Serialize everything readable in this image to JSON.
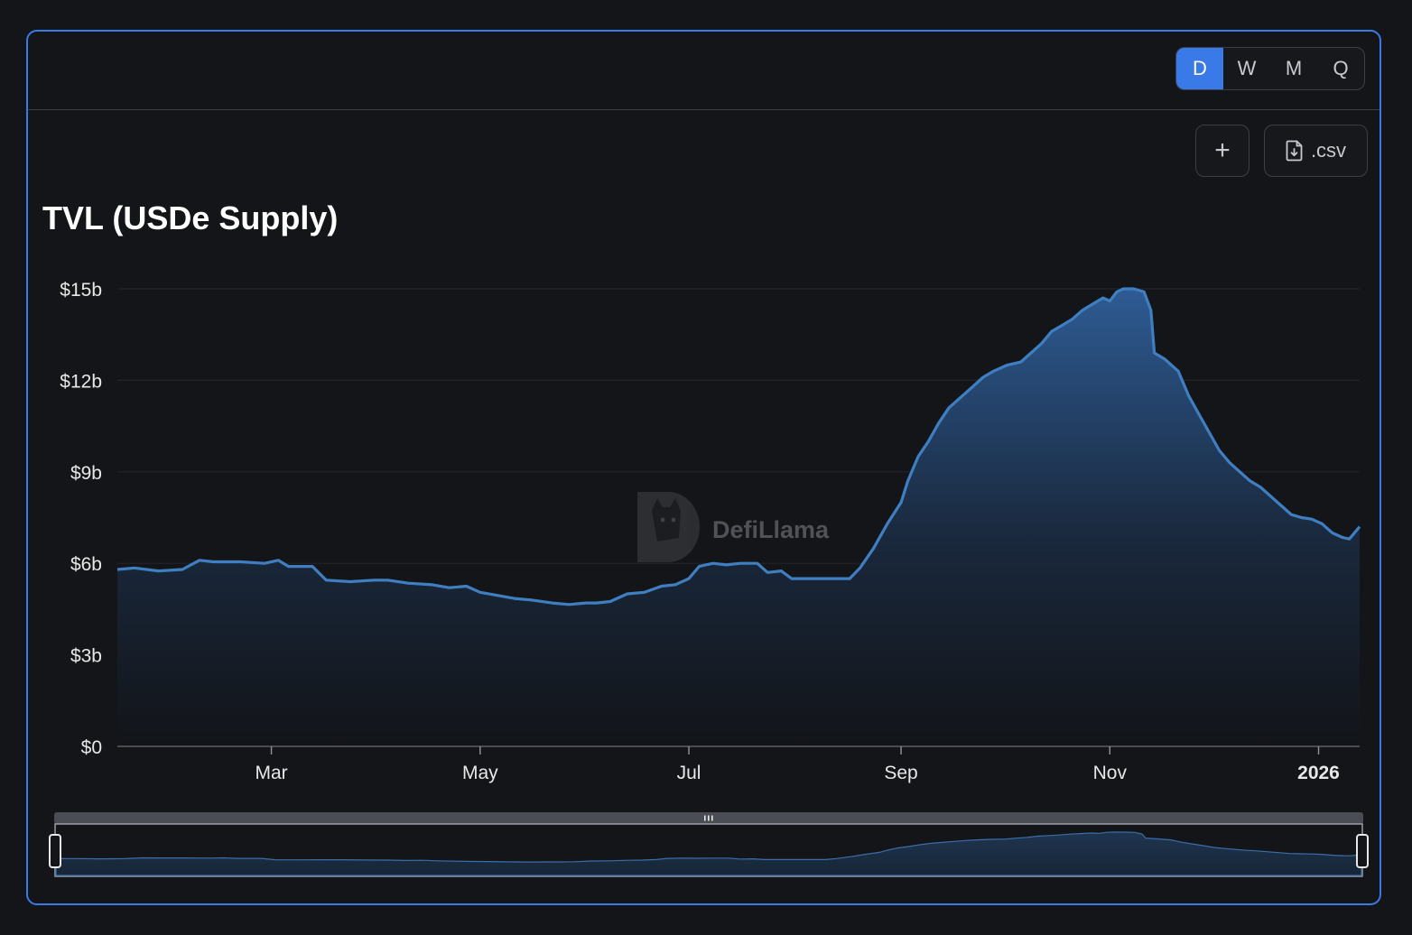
{
  "period_buttons": [
    "D",
    "W",
    "M",
    "Q"
  ],
  "active_period": "D",
  "toolbar": {
    "add_label": "+",
    "csv_label": ".csv"
  },
  "watermark": "DefiLlama",
  "colors": {
    "accent": "#3a7ae8",
    "line": "#3f7fc1",
    "background": "#141518",
    "border": "#3a3f47"
  },
  "chart_data": {
    "type": "area",
    "title": "TVL (USDe Supply)",
    "xlabel": "",
    "ylabel": "",
    "y_unit": "USD billions",
    "ylim": [
      0,
      15
    ],
    "y_ticks": [
      0,
      3,
      6,
      9,
      12,
      15
    ],
    "y_tick_labels": [
      "$0",
      "$3b",
      "$6b",
      "$9b",
      "$12b",
      "$15b"
    ],
    "x_ticks": [
      {
        "date": "2025-03-01",
        "label": "Mar",
        "bold": false
      },
      {
        "date": "2025-05-01",
        "label": "May",
        "bold": false
      },
      {
        "date": "2025-07-01",
        "label": "Jul",
        "bold": false
      },
      {
        "date": "2025-09-01",
        "label": "Sep",
        "bold": false
      },
      {
        "date": "2025-11-01",
        "label": "Nov",
        "bold": false
      },
      {
        "date": "2026-01-01",
        "label": "2026",
        "bold": true
      }
    ],
    "x_range": [
      "2025-01-15",
      "2026-01-13"
    ],
    "grid": true,
    "legend": "none",
    "series": [
      {
        "points": [
          [
            "2025-01-15",
            5.8
          ],
          [
            "2025-01-20",
            5.85
          ],
          [
            "2025-01-27",
            5.75
          ],
          [
            "2025-02-03",
            5.8
          ],
          [
            "2025-02-08",
            6.1
          ],
          [
            "2025-02-12",
            6.05
          ],
          [
            "2025-02-20",
            6.05
          ],
          [
            "2025-02-27",
            6.0
          ],
          [
            "2025-03-03",
            6.1
          ],
          [
            "2025-03-06",
            5.9
          ],
          [
            "2025-03-13",
            5.9
          ],
          [
            "2025-03-17",
            5.45
          ],
          [
            "2025-03-24",
            5.4
          ],
          [
            "2025-03-31",
            5.45
          ],
          [
            "2025-04-04",
            5.45
          ],
          [
            "2025-04-10",
            5.35
          ],
          [
            "2025-04-17",
            5.3
          ],
          [
            "2025-04-22",
            5.2
          ],
          [
            "2025-04-27",
            5.25
          ],
          [
            "2025-05-01",
            5.05
          ],
          [
            "2025-05-06",
            4.95
          ],
          [
            "2025-05-11",
            4.85
          ],
          [
            "2025-05-16",
            4.8
          ],
          [
            "2025-05-22",
            4.7
          ],
          [
            "2025-05-27",
            4.65
          ],
          [
            "2025-06-01",
            4.7
          ],
          [
            "2025-06-04",
            4.7
          ],
          [
            "2025-06-08",
            4.75
          ],
          [
            "2025-06-13",
            5.0
          ],
          [
            "2025-06-18",
            5.05
          ],
          [
            "2025-06-23",
            5.25
          ],
          [
            "2025-06-27",
            5.3
          ],
          [
            "2025-07-01",
            5.5
          ],
          [
            "2025-07-04",
            5.9
          ],
          [
            "2025-07-08",
            6.0
          ],
          [
            "2025-07-12",
            5.95
          ],
          [
            "2025-07-16",
            6.0
          ],
          [
            "2025-07-21",
            6.0
          ],
          [
            "2025-07-24",
            5.7
          ],
          [
            "2025-07-28",
            5.75
          ],
          [
            "2025-07-31",
            5.5
          ],
          [
            "2025-08-05",
            5.5
          ],
          [
            "2025-08-10",
            5.5
          ],
          [
            "2025-08-14",
            5.5
          ],
          [
            "2025-08-17",
            5.5
          ],
          [
            "2025-08-20",
            5.85
          ],
          [
            "2025-08-24",
            6.5
          ],
          [
            "2025-08-28",
            7.3
          ],
          [
            "2025-09-01",
            8.0
          ],
          [
            "2025-09-03",
            8.7
          ],
          [
            "2025-09-06",
            9.5
          ],
          [
            "2025-09-09",
            10.0
          ],
          [
            "2025-09-12",
            10.6
          ],
          [
            "2025-09-15",
            11.1
          ],
          [
            "2025-09-18",
            11.4
          ],
          [
            "2025-09-22",
            11.8
          ],
          [
            "2025-09-25",
            12.1
          ],
          [
            "2025-09-28",
            12.3
          ],
          [
            "2025-10-02",
            12.5
          ],
          [
            "2025-10-06",
            12.6
          ],
          [
            "2025-10-09",
            12.9
          ],
          [
            "2025-10-12",
            13.2
          ],
          [
            "2025-10-15",
            13.6
          ],
          [
            "2025-10-18",
            13.8
          ],
          [
            "2025-10-21",
            14.0
          ],
          [
            "2025-10-24",
            14.3
          ],
          [
            "2025-10-27",
            14.5
          ],
          [
            "2025-10-30",
            14.7
          ],
          [
            "2025-11-01",
            14.6
          ],
          [
            "2025-11-03",
            14.9
          ],
          [
            "2025-11-05",
            15.0
          ],
          [
            "2025-11-08",
            15.0
          ],
          [
            "2025-11-11",
            14.9
          ],
          [
            "2025-11-13",
            14.3
          ],
          [
            "2025-11-14",
            12.9
          ],
          [
            "2025-11-17",
            12.7
          ],
          [
            "2025-11-21",
            12.3
          ],
          [
            "2025-11-24",
            11.5
          ],
          [
            "2025-11-27",
            10.9
          ],
          [
            "2025-11-30",
            10.3
          ],
          [
            "2025-12-03",
            9.7
          ],
          [
            "2025-12-06",
            9.3
          ],
          [
            "2025-12-09",
            9.0
          ],
          [
            "2025-12-12",
            8.7
          ],
          [
            "2025-12-15",
            8.5
          ],
          [
            "2025-12-18",
            8.2
          ],
          [
            "2025-12-21",
            7.9
          ],
          [
            "2025-12-24",
            7.6
          ],
          [
            "2025-12-27",
            7.5
          ],
          [
            "2025-12-30",
            7.45
          ],
          [
            "2026-01-02",
            7.3
          ],
          [
            "2026-01-05",
            7.0
          ],
          [
            "2026-01-08",
            6.85
          ],
          [
            "2026-01-10",
            6.8
          ],
          [
            "2026-01-13",
            7.2
          ]
        ]
      }
    ]
  }
}
